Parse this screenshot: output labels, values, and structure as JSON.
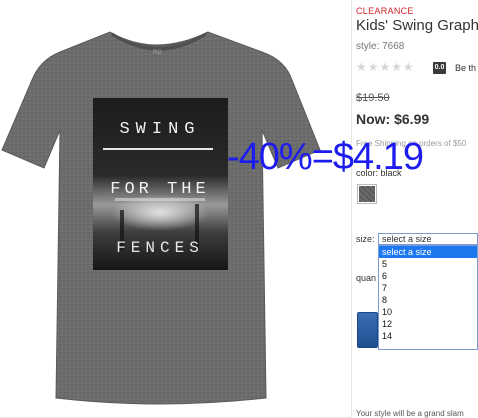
{
  "product": {
    "badge": "CLEARANCE",
    "title": "Kids' Swing Graph",
    "style": "style: 7668",
    "stars": "★★★★★",
    "rating_badge": "0.0",
    "review_cta": "Be th",
    "was_price": "$19.50",
    "now_price": "Now: $6.99",
    "free_shipping": "Free Shipping on orders of $50",
    "color_label": "color: black",
    "size_label": "size:",
    "size_select_value": "select a size",
    "size_options": [
      "select a size",
      "5",
      "6",
      "7",
      "8",
      "10",
      "12",
      "14"
    ],
    "quantity_label": "quan",
    "bottom_text": "Your style will be a grand slam"
  },
  "shirt_print": {
    "line1": "SWING",
    "line2": "FOR THE",
    "line3": "FENCES"
  },
  "overlay": {
    "text": "-40%=$4.19"
  },
  "colors": {
    "clearance": "#d2232a",
    "overlay": "#1c1cf0",
    "selected_option": "#1e78f0",
    "shirt": "#6b6b6b"
  }
}
